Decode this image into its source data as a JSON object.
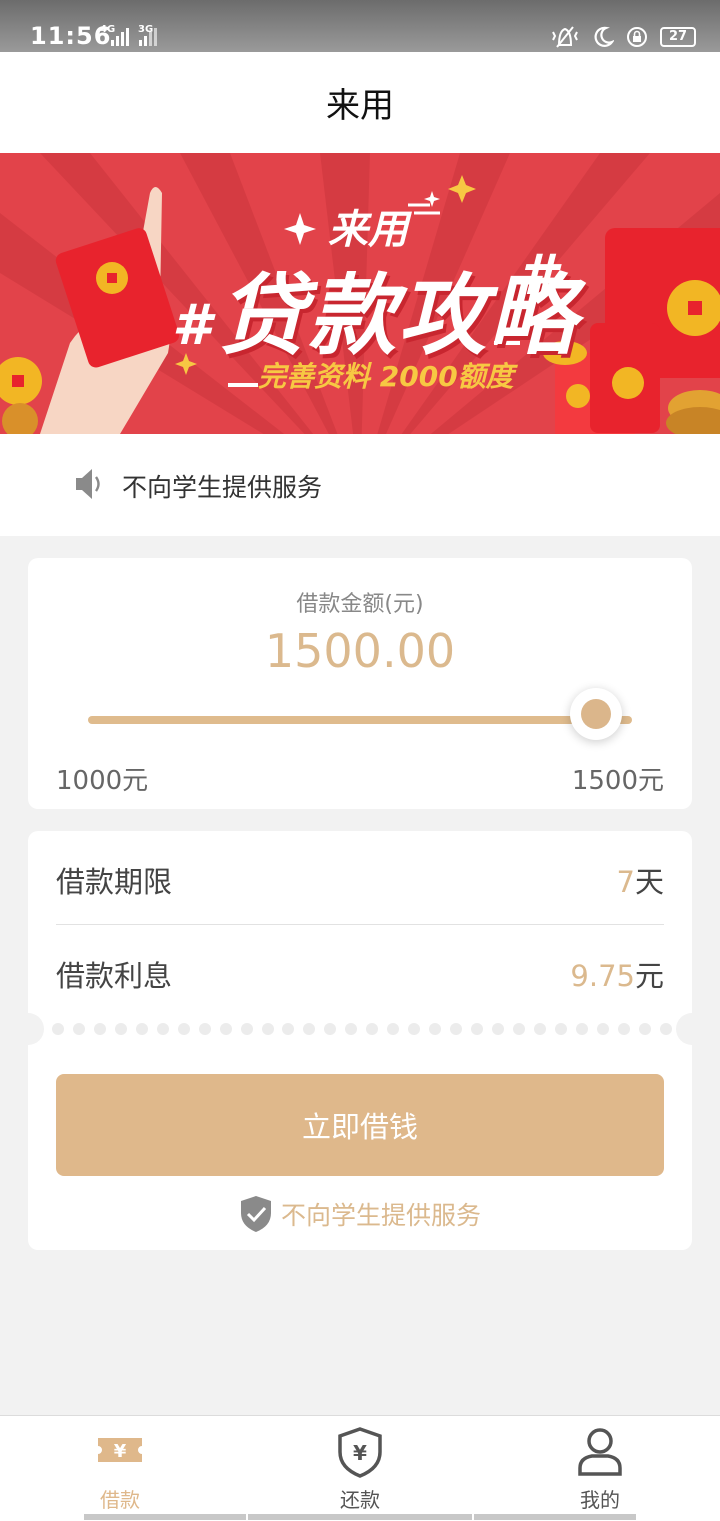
{
  "status_bar": {
    "time": "11:56",
    "network_1": "4G",
    "network_2": "3G",
    "battery": "27",
    "icons": [
      "vibrate-icon",
      "moon-icon",
      "rotation-lock-icon",
      "battery-icon"
    ]
  },
  "header": {
    "title": "来用"
  },
  "banner": {
    "brand": "来用",
    "headline": "贷款攻略",
    "hash": "#",
    "subline": "完善资料 2000额度"
  },
  "notice": {
    "text": "不向学生提供服务",
    "icon": "speaker-icon"
  },
  "loan": {
    "amount_label": "借款金额(元)",
    "amount_value": "1500.00",
    "min_label": "1000元",
    "max_label": "1500元",
    "slider_fraction": 1.0
  },
  "details": {
    "term_label": "借款期限",
    "term_value": "7",
    "term_unit": "天",
    "interest_label": "借款利息",
    "interest_value": "9.75",
    "interest_unit": "元"
  },
  "action": {
    "borrow_button": "立即借钱",
    "footer_notice": "不向学生提供服务",
    "footer_icon": "shield-check-icon"
  },
  "tabs": [
    {
      "label": "借款",
      "icon": "yen-ticket-icon",
      "active": true
    },
    {
      "label": "还款",
      "icon": "yen-shield-icon",
      "active": false
    },
    {
      "label": "我的",
      "icon": "user-icon",
      "active": false
    }
  ],
  "colors": {
    "accent": "#dfb88b",
    "banner_red": "#e2434a",
    "tab_inactive": "#555555"
  }
}
